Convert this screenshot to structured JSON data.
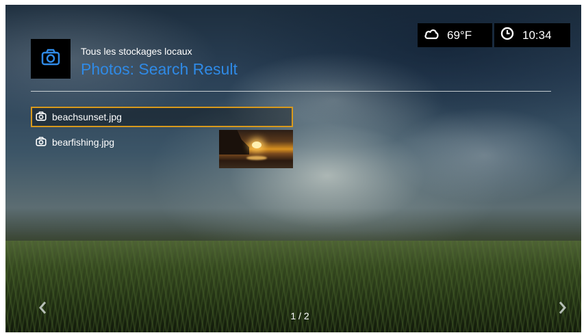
{
  "header": {
    "breadcrumb": "Tous les stockages locaux",
    "title": "Photos: Search Result",
    "app_icon": "camera-icon"
  },
  "status": {
    "weather_icon": "cloud-icon",
    "temperature": "69°F",
    "clock_icon": "clock-icon",
    "time": "10:34"
  },
  "files": [
    {
      "name": "beachsunset.jpg",
      "icon": "camera-icon",
      "selected": true
    },
    {
      "name": "bearfishing.jpg",
      "icon": "camera-icon",
      "selected": false
    }
  ],
  "preview": {
    "description_icon": "sunset-thumbnail"
  },
  "pagination": {
    "text": "1 / 2",
    "prev_icon": "chevron-left-icon",
    "next_icon": "chevron-right-icon"
  },
  "colors": {
    "accent": "#2f8ae6",
    "selection": "#d99a1c"
  }
}
